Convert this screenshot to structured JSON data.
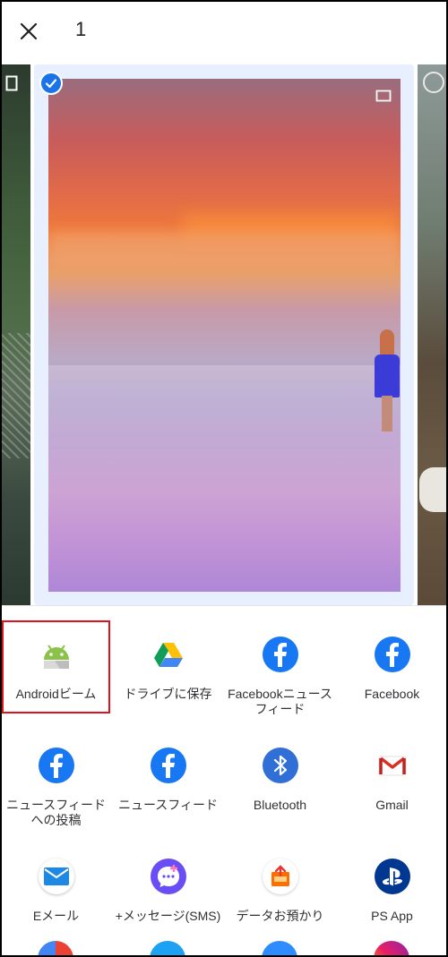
{
  "header": {
    "selected_count": "1"
  },
  "share_targets": [
    {
      "label": "Androidビーム",
      "icon": "android-beam-icon"
    },
    {
      "label": "ドライブに保存",
      "icon": "google-drive-icon"
    },
    {
      "label": "Facebookニュースフィード",
      "icon": "facebook-icon"
    },
    {
      "label": "Facebook",
      "icon": "facebook-icon"
    },
    {
      "label": "ニュースフィードへの投稿",
      "icon": "facebook-icon"
    },
    {
      "label": "ニュースフィード",
      "icon": "facebook-icon"
    },
    {
      "label": "Bluetooth",
      "icon": "bluetooth-icon"
    },
    {
      "label": "Gmail",
      "icon": "gmail-icon"
    },
    {
      "label": "Eメール",
      "icon": "email-icon"
    },
    {
      "label": "+メッセージ(SMS)",
      "icon": "plus-message-icon"
    },
    {
      "label": "データお預かり",
      "icon": "data-backup-icon"
    },
    {
      "label": "PS App",
      "icon": "playstation-icon"
    }
  ],
  "colors": {
    "accent": "#1a73e8",
    "highlight_border": "#e0121b",
    "facebook": "#1877f2"
  }
}
